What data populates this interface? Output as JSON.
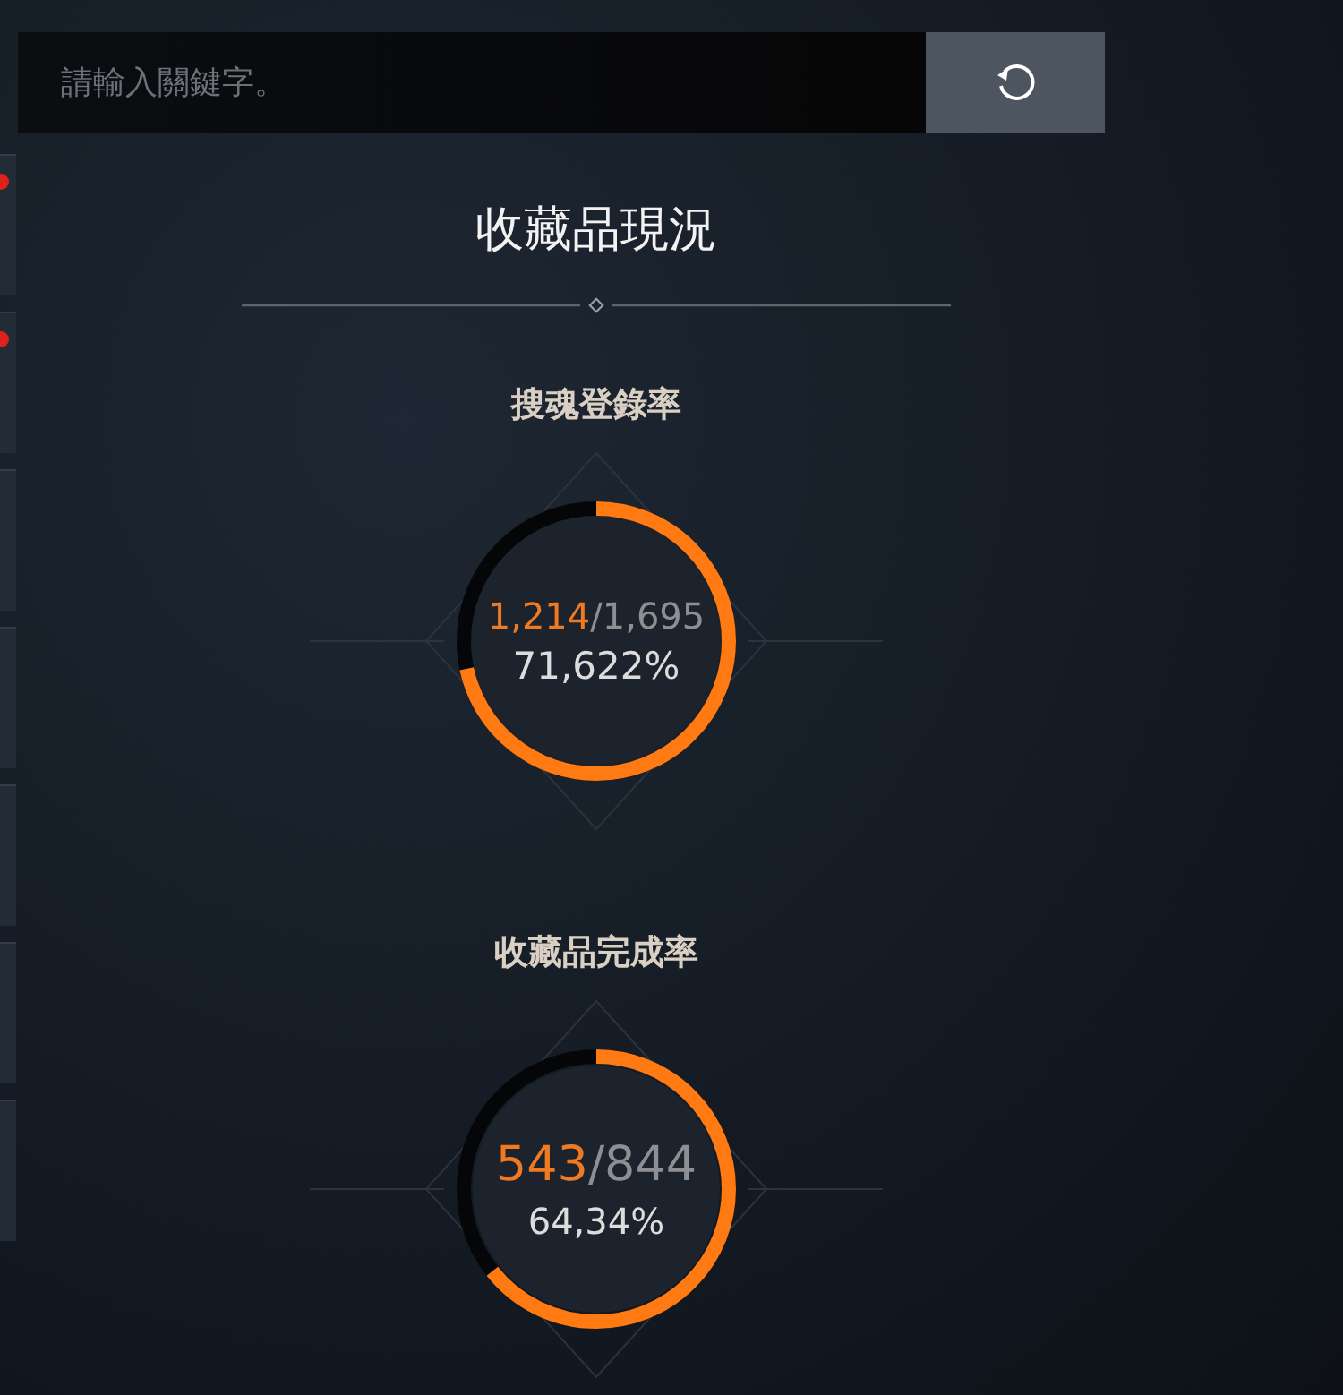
{
  "side_tiles": [
    {
      "alert": true
    },
    {
      "alert": true
    },
    {
      "alert": false
    },
    {
      "alert": false
    },
    {
      "alert": false
    },
    {
      "alert": false
    },
    {
      "alert": false
    }
  ],
  "search": {
    "placeholder": "請輸入關鍵字。"
  },
  "title": "收藏品現況",
  "stats": [
    {
      "label": "搜魂登錄率",
      "count": "1,214",
      "total": "/1,695",
      "percent": "71,622%"
    },
    {
      "label": "收藏品完成率",
      "count": "543",
      "total": "/844",
      "percent": "64,34%"
    }
  ]
}
